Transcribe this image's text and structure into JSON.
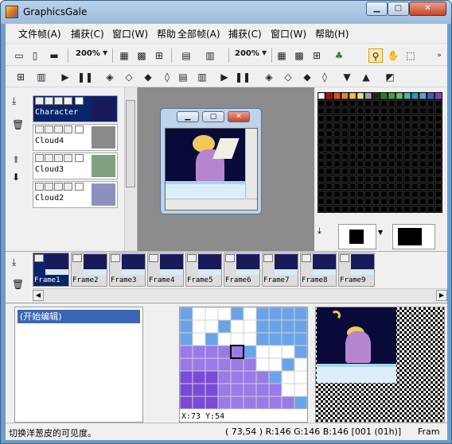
{
  "window": {
    "title": "GraphicsGale",
    "min_label": "▁",
    "max_label": "▢",
    "close_label": "✕"
  },
  "menus": [
    {
      "label": "文件帧(A)"
    },
    {
      "label": "捕获(C)"
    },
    {
      "label": "窗口(W)"
    },
    {
      "label": "帮助"
    },
    {
      "label": "全部帧(A)"
    },
    {
      "label": "捕获(C)"
    },
    {
      "label": "窗口(W)"
    },
    {
      "label": "帮助(H)"
    }
  ],
  "toolbar": {
    "zoom1": "200%",
    "zoom2": "200%"
  },
  "layers": [
    {
      "name": "Character"
    },
    {
      "name": "Cloud4"
    },
    {
      "name": "Cloud3"
    },
    {
      "name": "Cloud2"
    }
  ],
  "frames": [
    {
      "name": "Frame1"
    },
    {
      "name": "Frame2"
    },
    {
      "name": "Frame3"
    },
    {
      "name": "Frame4"
    },
    {
      "name": "Frame5"
    },
    {
      "name": "Frame6"
    },
    {
      "name": "Frame7"
    },
    {
      "name": "Frame8"
    },
    {
      "name": "Frame9"
    }
  ],
  "image_window": {
    "min_label": "▁",
    "max_label": "▢",
    "close_label": "✕"
  },
  "history": {
    "items": [
      "(开始编辑)"
    ]
  },
  "magnifier": {
    "coords": "X:73 Y:54"
  },
  "status": {
    "hint": "切换洋葱皮的可见度。",
    "pixel": "( 73,54 ) R:146 G:146 B:146 [001 (01h)]",
    "frame": "Fram"
  },
  "colors": {
    "accent_blue": "#0a246a",
    "title_blue": "#9dbbdc",
    "selection": "#3b66b5",
    "purple_pixel": "#9a7ae8",
    "blue_pixel": "#6aa3e8"
  },
  "icons": [
    "new-icon",
    "open-icon",
    "save-icon",
    "grid-icon",
    "fine-grid-icon",
    "select-grid-icon",
    "snap-icon",
    "zoom-icon",
    "hand-icon",
    "crop-icon",
    "play-icon",
    "pause-icon",
    "onion-skin-icon",
    "trash-icon",
    "arrow-up-icon",
    "arrow-down-icon",
    "eye-icon",
    "lock-icon"
  ]
}
